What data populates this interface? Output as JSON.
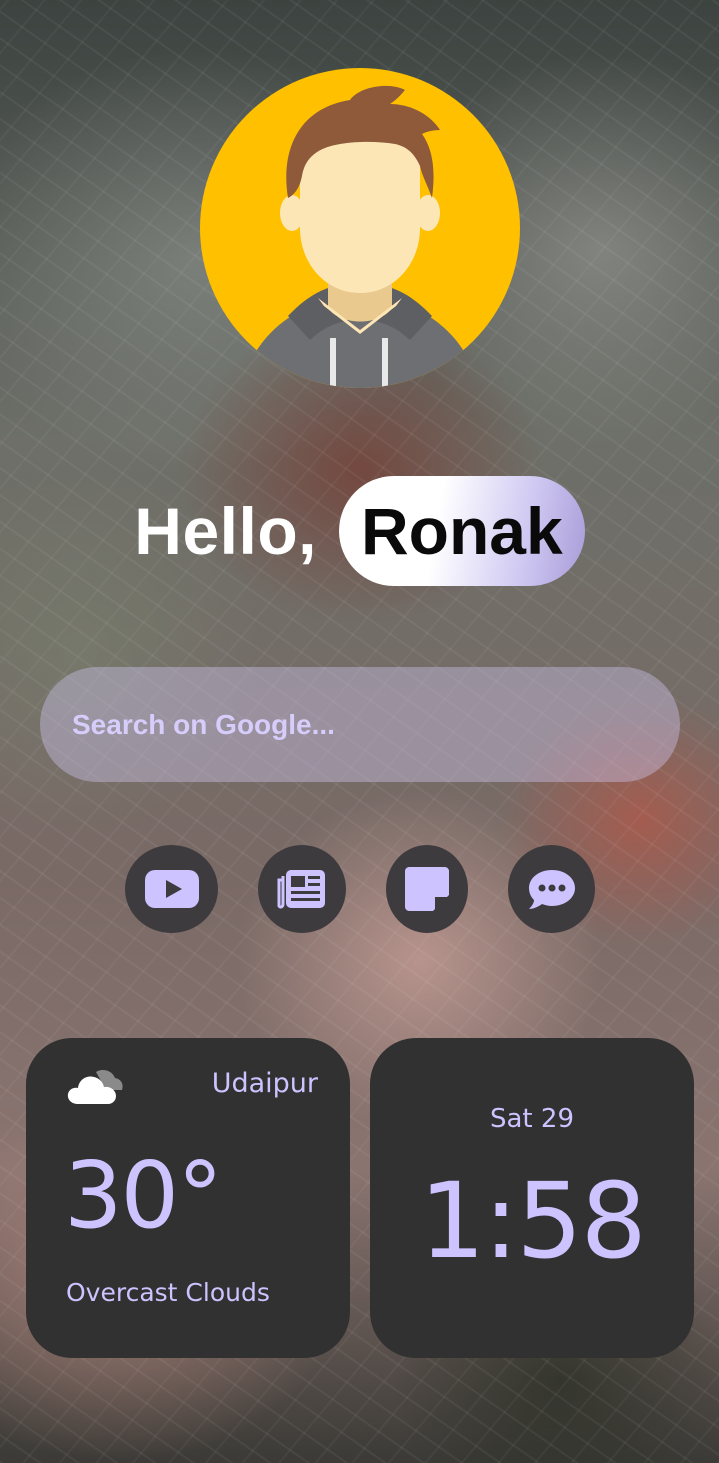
{
  "greeting": {
    "hello": "Hello,",
    "name": "Ronak"
  },
  "search": {
    "placeholder": "Search on Google..."
  },
  "shortcuts": [
    {
      "icon": "youtube-icon"
    },
    {
      "icon": "newspaper-icon"
    },
    {
      "icon": "sticky-note-icon"
    },
    {
      "icon": "chat-icon"
    }
  ],
  "weather": {
    "icon": "cloud-icon",
    "city": "Udaipur",
    "temperature": "30°",
    "condition": "Overcast Clouds"
  },
  "clock": {
    "date": "Sat 29",
    "time": "1:58"
  },
  "colors": {
    "accent": "#ccc3ff",
    "card_bg": "#313131",
    "avatar_bg": "#ffc000",
    "shortcut_bg": "#3e3b3f"
  }
}
